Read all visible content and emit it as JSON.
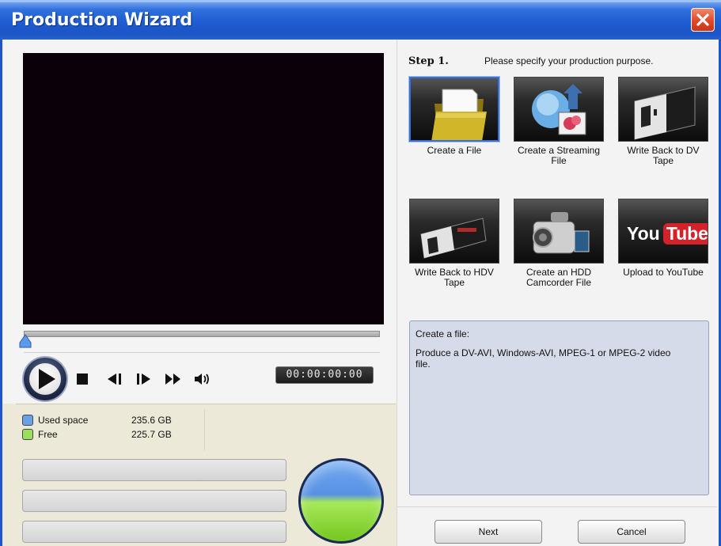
{
  "window": {
    "title": "Production Wizard"
  },
  "player": {
    "timecode": "00:00:00:00",
    "position_fraction": 0.0
  },
  "disk": {
    "legend": [
      {
        "label": "Used space",
        "value": "235.6 GB",
        "color": "#6aa0e8"
      },
      {
        "label": "Free",
        "value": "225.7 GB",
        "color": "#9be05a"
      }
    ]
  },
  "step": {
    "label": "Step 1.",
    "instruction": "Please specify your production purpose."
  },
  "options": [
    {
      "label": "Create a File",
      "selected": true,
      "icon": "folder-icon"
    },
    {
      "label": "Create a Streaming File",
      "selected": false,
      "icon": "globe-icon"
    },
    {
      "label": "Write Back to DV Tape",
      "selected": false,
      "icon": "dv-tape-icon"
    },
    {
      "label": "Write Back to HDV Tape",
      "selected": false,
      "icon": "hdv-tape-icon"
    },
    {
      "label": "Create an HDD Camcorder File",
      "selected": false,
      "icon": "camcorder-icon"
    },
    {
      "label": "Upload to YouTube",
      "selected": false,
      "icon": "youtube-icon"
    }
  ],
  "youtube_logo": {
    "you": "You",
    "tube": "Tube"
  },
  "description": {
    "title": "Create a file:",
    "body": "Produce a DV-AVI, Windows-AVI, MPEG-1 or MPEG-2 video file."
  },
  "buttons": {
    "next": "Next",
    "cancel": "Cancel"
  },
  "colors": {
    "titlebar": "#1e5cd1",
    "selection": "#3a6fd6",
    "desc_bg": "#d6dbea"
  }
}
